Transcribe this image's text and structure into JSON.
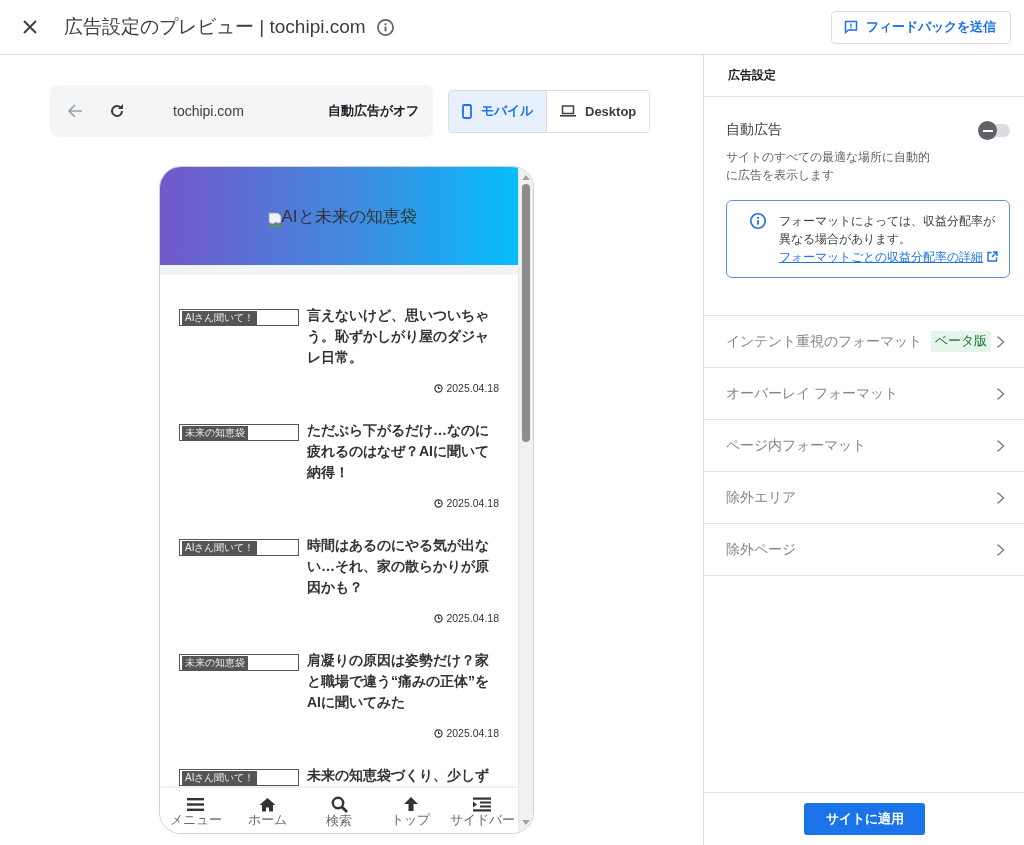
{
  "header": {
    "title": "広告設定のプレビュー | tochipi.com",
    "feedback_button": "フィードバックを送信"
  },
  "preview": {
    "url": "tochipi.com",
    "status": "自動広告がオフ",
    "devices": [
      {
        "label": "モバイル",
        "kind": "mobile",
        "selected": true
      },
      {
        "label": "Desktop",
        "kind": "desktop",
        "selected": false
      }
    ],
    "site": {
      "logo_alt": "AIと未来の知恵袋",
      "articles": [
        {
          "category": "AIさん聞いて！",
          "title": "言えないけど、思いついちゃう。恥ずかしがり屋のダジャレ日常。",
          "date": "2025.04.18"
        },
        {
          "category": "未来の知恵袋",
          "title": "ただぶら下がるだけ…なのに疲れるのはなぜ？AIに聞いて納得！",
          "date": "2025.04.18"
        },
        {
          "category": "AIさん聞いて！",
          "title": "時間はあるのにやる気が出ない…それ、家の散らかりが原因かも？",
          "date": "2025.04.18"
        },
        {
          "category": "未来の知恵袋",
          "title": "肩凝りの原因は姿勢だけ？家と職場で違う“痛みの正体”をAIに聞いてみた",
          "date": "2025.04.18"
        },
        {
          "category": "AIさん聞いて！",
          "title": "未来の知恵袋づくり、少しず"
        }
      ],
      "nav": [
        {
          "label": "メニュー",
          "kind": "menu"
        },
        {
          "label": "ホーム",
          "kind": "home"
        },
        {
          "label": "検索",
          "kind": "search"
        },
        {
          "label": "トップ",
          "kind": "top"
        },
        {
          "label": "サイドバー",
          "kind": "sidebar"
        }
      ]
    }
  },
  "settings": {
    "title": "広告設定",
    "auto_ads": {
      "label": "自動広告",
      "on": false,
      "description": "サイトのすべての最適な場所に自動的に広告を表示します"
    },
    "notice": {
      "text": "フォーマットによっては、収益分配率が異なる場合があります。",
      "link": "フォーマットごとの収益分配率の詳細"
    },
    "sections": [
      {
        "label": "インテント重視のフォーマット",
        "badge": "ベータ版"
      },
      {
        "label": "オーバーレイ フォーマット"
      },
      {
        "label": "ページ内フォーマット"
      },
      {
        "label": "除外エリア"
      },
      {
        "label": "除外ページ"
      }
    ],
    "apply_button": "サイトに適用"
  }
}
